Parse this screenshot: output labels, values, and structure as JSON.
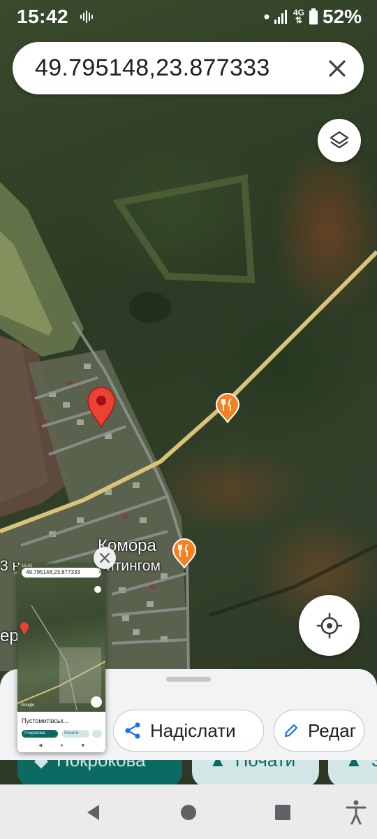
{
  "status_bar": {
    "time": "15:42",
    "network": "4G",
    "battery": "52%",
    "icons": [
      "sound-wave-icon",
      "dot-icon",
      "signal-icon",
      "data-arrows-icon",
      "battery-icon"
    ]
  },
  "search": {
    "query": "49.795148,23.877333",
    "close_icon": "close-icon"
  },
  "map": {
    "type": "satellite",
    "labels": {
      "place_line1": "Комора",
      "place_line2": "итингом",
      "left_fragment_top": "3 н",
      "left_fragment_bottom": "ер"
    },
    "pin_color": "#ea4335",
    "poi_color": "#f5821f",
    "road_color": "#d9c27a",
    "pois": [
      "restaurant-icon",
      "restaurant-icon"
    ]
  },
  "controls": {
    "layers_icon": "layers-icon",
    "my_location_icon": "my-location-icon"
  },
  "pip": {
    "status_time": "15:42",
    "query": "49.795148,23.877333",
    "close_glyph": "×",
    "place_title": "Пустомитівськ...",
    "chip_1": "Покрокова",
    "chip_2": "Почати",
    "chip_3": "",
    "nav": "◀ ● ■",
    "google_label": "Google"
  },
  "actions": {
    "share_label": "Надіслати",
    "edit_label": "Редаг",
    "directions_label": "Покрокова",
    "start_label": "Почати",
    "other_label": "З"
  },
  "colors": {
    "accent": "#1a73e8",
    "teal_dark": "#0b6b63",
    "teal_light": "#d3e6e6"
  },
  "navbar": {
    "icons": [
      "back-icon",
      "home-icon",
      "recents-icon",
      "accessibility-icon"
    ]
  }
}
